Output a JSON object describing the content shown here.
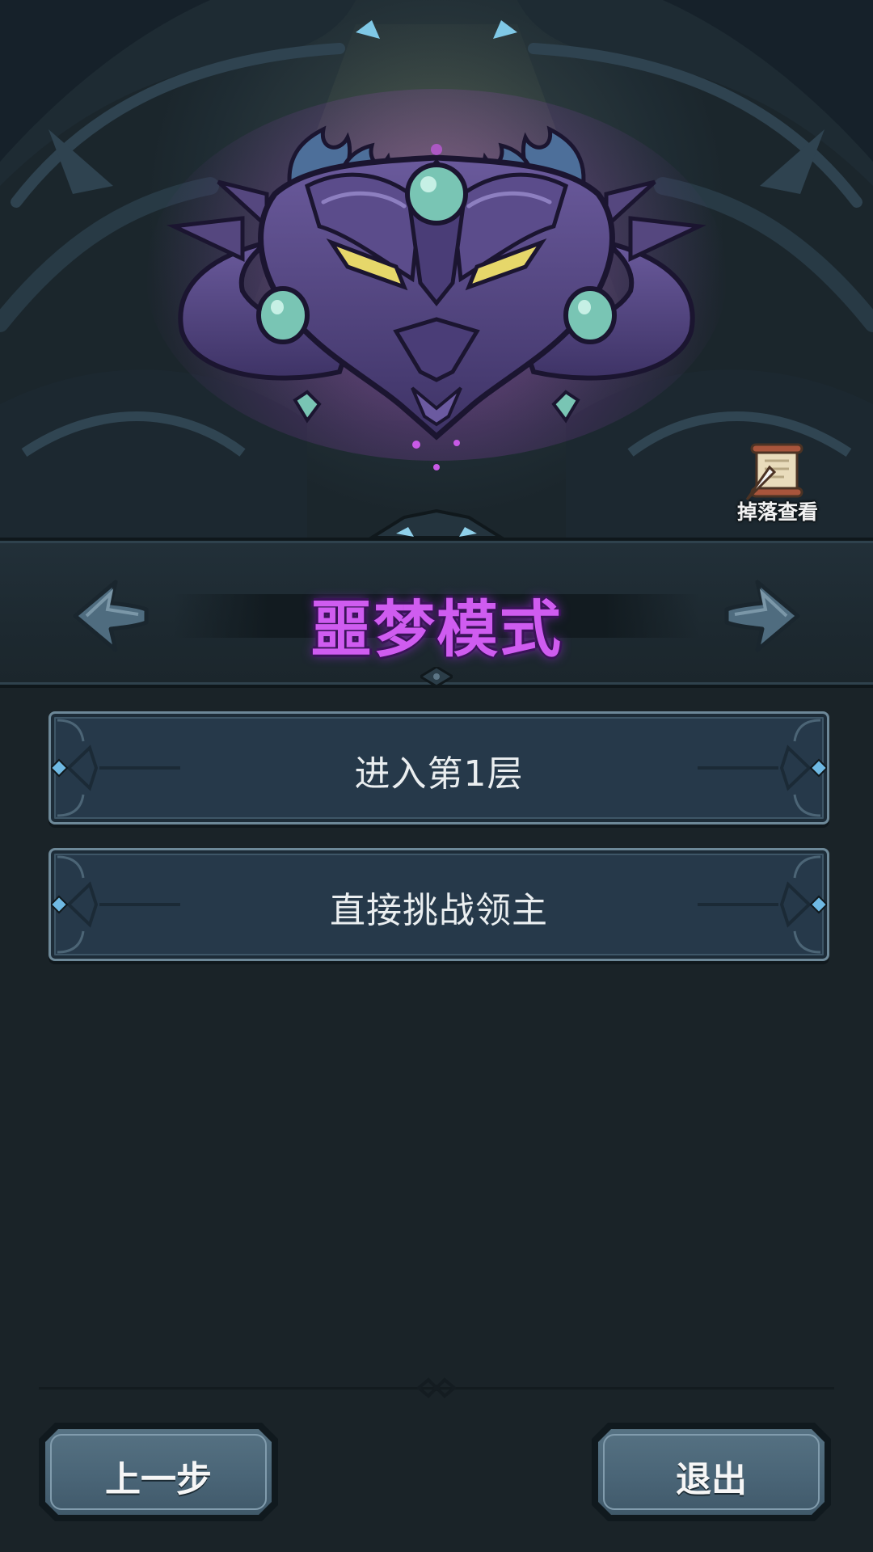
{
  "hero": {
    "emblem": "nightmare-demon-mask-emblem",
    "drop_view": {
      "icon": "scroll-quill-icon",
      "label": "掉落查看"
    }
  },
  "mode_selector": {
    "title": "噩梦模式",
    "title_color": "#cf5cf0",
    "prev_icon": "arrow-left-icon",
    "next_icon": "arrow-right-icon"
  },
  "options": [
    {
      "label": "进入第1层"
    },
    {
      "label": "直接挑战领主"
    }
  ],
  "footer": {
    "back_label": "上一步",
    "exit_label": "退出"
  }
}
